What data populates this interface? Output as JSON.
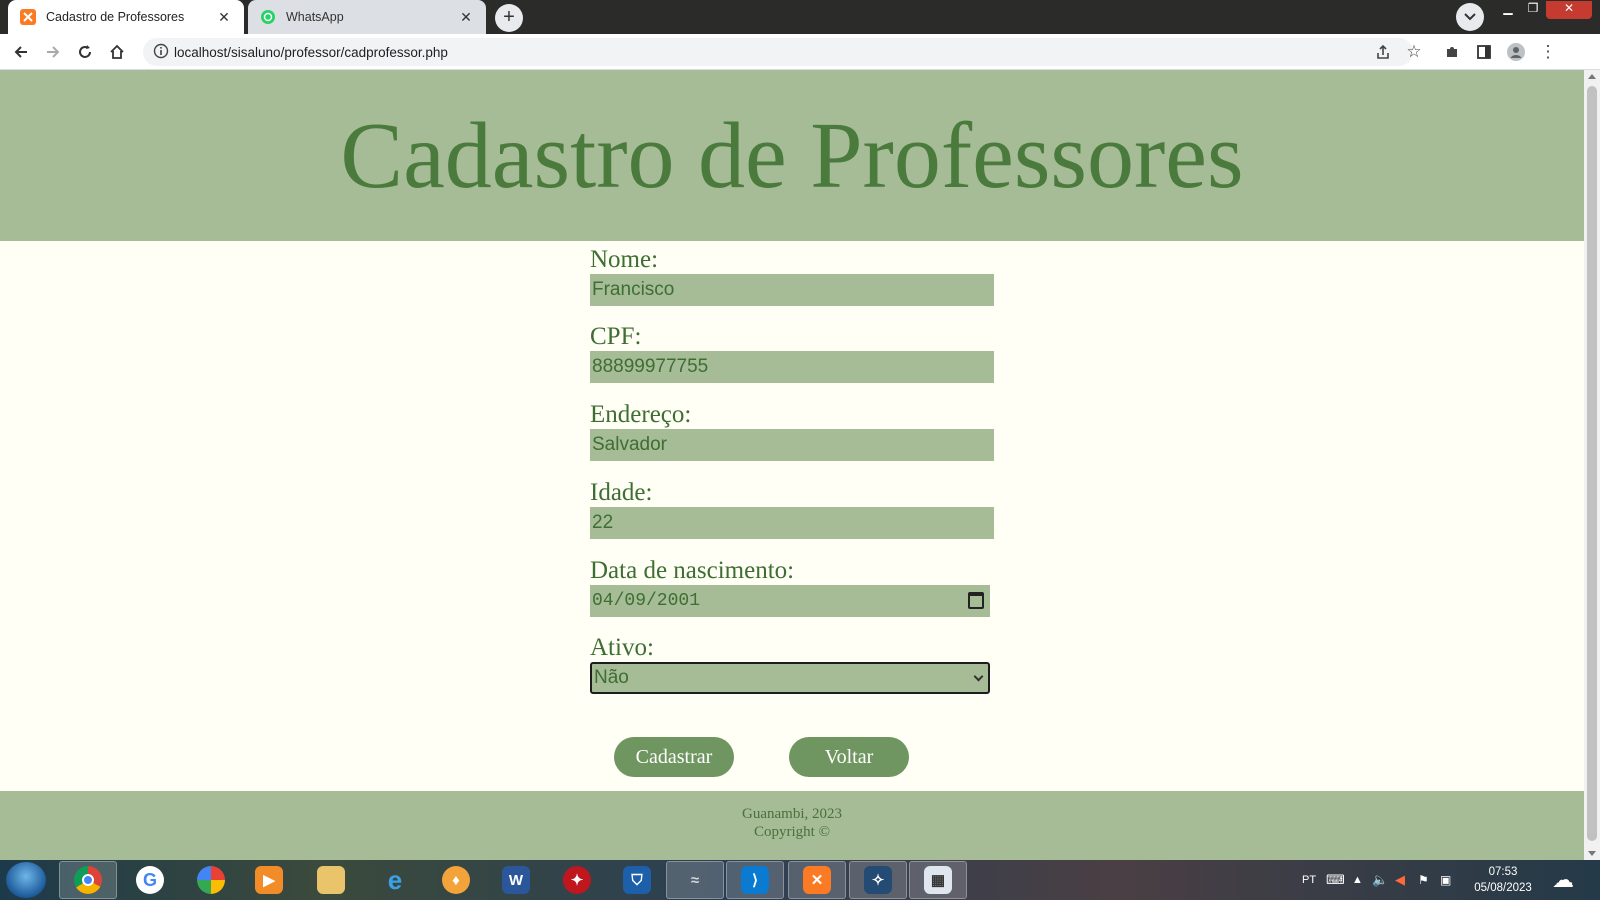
{
  "browser": {
    "tabs": [
      {
        "title": "Cadastro de Professores",
        "active": true
      },
      {
        "title": "WhatsApp",
        "active": false
      }
    ],
    "url": "localhost/sisaluno/professor/cadprofessor.php"
  },
  "page": {
    "title": "Cadastro de Professores",
    "form": {
      "nome": {
        "label": "Nome:",
        "value": "Francisco"
      },
      "cpf": {
        "label": "CPF:",
        "value": "88899977755"
      },
      "endereco": {
        "label": "Endereço:",
        "value": "Salvador"
      },
      "idade": {
        "label": "Idade:",
        "value": "22"
      },
      "nascimento": {
        "label": "Data de nascimento:",
        "value": "04/09/2001"
      },
      "ativo": {
        "label": "Ativo:",
        "value": "Não"
      }
    },
    "buttons": {
      "cadastrar": "Cadastrar",
      "voltar": "Voltar"
    },
    "footer": {
      "line1": "Guanambi, 2023",
      "line2": "Copyright ©"
    }
  },
  "taskbar": {
    "language": "PT",
    "time": "07:53",
    "date": "05/08/2023"
  },
  "colors": {
    "header_bg": "#a5bc97",
    "title_text": "#4b7a3d",
    "page_bg": "#fffff5",
    "button_bg": "#6f9660"
  }
}
